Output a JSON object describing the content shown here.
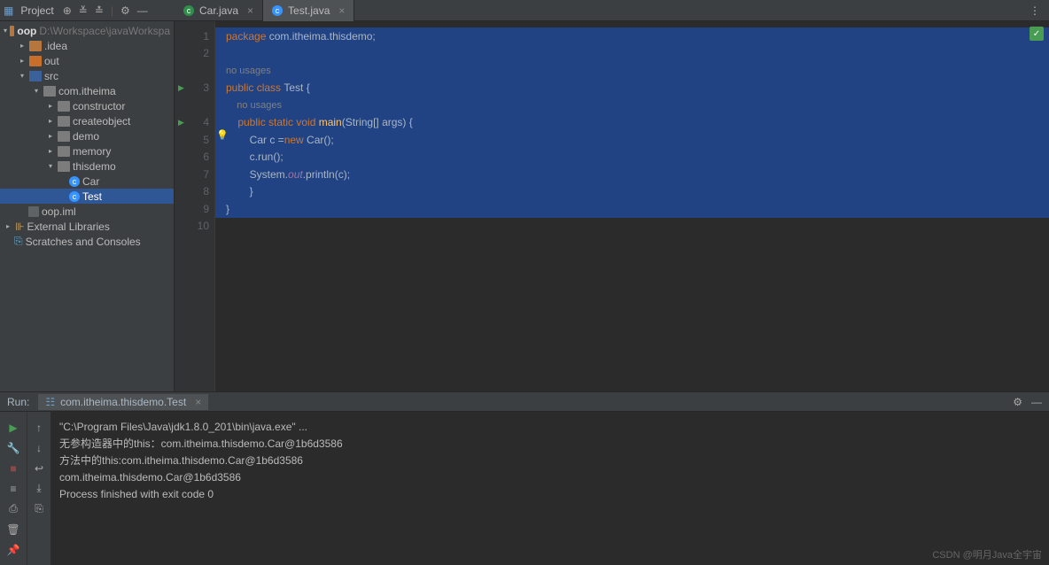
{
  "toolbar": {
    "project_label": "Project"
  },
  "tabs": [
    {
      "label": "Car.java",
      "active": false
    },
    {
      "label": "Test.java",
      "active": true
    }
  ],
  "tree": {
    "root": "oop",
    "root_path": "D:\\Workspace\\javaWorkspa",
    "idea": ".idea",
    "out": "out",
    "src": "src",
    "pkg": "com.itheima",
    "constructor": "constructor",
    "createobject": "createobject",
    "demo": "demo",
    "memory": "memory",
    "thisdemo": "thisdemo",
    "car": "Car",
    "test": "Test",
    "iml": "oop.iml",
    "ext": "External Libraries",
    "scratches": "Scratches and Consoles"
  },
  "code": {
    "l1a": "package",
    "l1b": " com.itheima.thisdemo;",
    "l2u": "no usages",
    "l3a": "public class ",
    "l3b": "Test {",
    "l4u": "    no usages",
    "l5a": "    public static void ",
    "l5b": "main",
    "l5c": "(String[] args) {",
    "l6a": "        Car c =",
    "l6b": "new ",
    "l6c": "Car();",
    "l7": "        c.run();",
    "l8a": "        System.",
    "l8b": "out",
    "l8c": ".println(c);",
    "l9": "        }",
    "l10": "}"
  },
  "gutter": [
    "1",
    "2",
    "",
    "3",
    "",
    "4",
    "5",
    "6",
    "7",
    "8",
    "9",
    "10"
  ],
  "run": {
    "label": "Run:",
    "tab": "com.itheima.thisdemo.Test",
    "lines": [
      "\"C:\\Program Files\\Java\\jdk1.8.0_201\\bin\\java.exe\" ...",
      "无参构造器中的this：com.itheima.thisdemo.Car@1b6d3586",
      "方法中的this:com.itheima.thisdemo.Car@1b6d3586",
      "com.itheima.thisdemo.Car@1b6d3586",
      "",
      "Process finished with exit code 0"
    ]
  },
  "watermark": "CSDN @明月Java全宇宙"
}
